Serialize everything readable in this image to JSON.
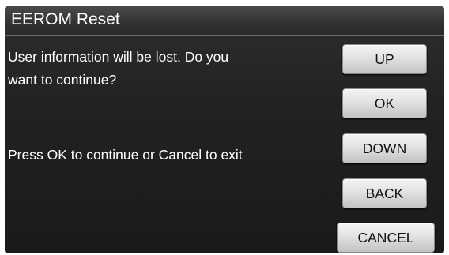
{
  "title_bar": {
    "title": "EEROM Reset"
  },
  "message": {
    "line_1": "User information will be lost. Do you",
    "line_2": "want to continue?",
    "instruction": "Press OK to continue or Cancel to exit"
  },
  "buttons": {
    "up": "UP",
    "ok": "OK",
    "down": "DOWN",
    "back": "BACK",
    "cancel": "CANCEL"
  }
}
